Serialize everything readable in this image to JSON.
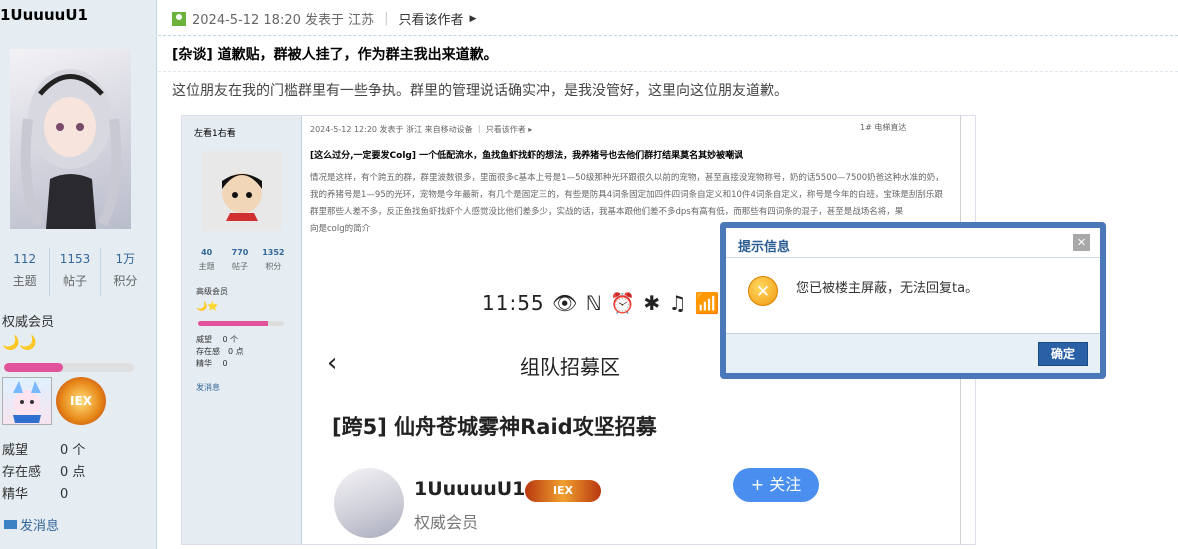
{
  "sidebar": {
    "username": "1UuuuuU1",
    "stats": [
      {
        "value": "112",
        "label": "主题"
      },
      {
        "value": "1153",
        "label": "帖子"
      },
      {
        "value": "1万",
        "label": "积分"
      }
    ],
    "rank": "权威会员",
    "rank_icons": "🌙🌙",
    "progress": 0.45,
    "medal1": "",
    "medal2": "IEX",
    "info": [
      {
        "key": "威望",
        "value": "0 个"
      },
      {
        "key": "存在感",
        "value": "0 点"
      },
      {
        "key": "精华",
        "value": "0"
      }
    ],
    "pm": "发消息"
  },
  "post": {
    "meta": "2024-5-12 18:20 发表于 江苏",
    "only_author": "只看该作者",
    "title": "[杂谈] 道歉贴，群被人挂了，作为群主我出来道歉。",
    "body": "这位朋友在我的门槛群里有一些争执。群里的管理说话确实冲，是我没管好，这里向这位朋友道歉。"
  },
  "embedded": {
    "side_label": "左看1右看",
    "avatar_glyph": "👦",
    "stats": [
      {
        "value": "40",
        "label": "主题"
      },
      {
        "value": "770",
        "label": "帖子"
      },
      {
        "value": "1352",
        "label": "积分"
      }
    ],
    "rank": "高级会员",
    "rank_icons": "🌙⭐",
    "info": [
      "威望　 0 个",
      "存在感　0 点",
      "精华　 0"
    ],
    "pm": "发消息",
    "meta": "2024-5-12 12:20 发表于 浙江 来自移动设备 ｜ 只看该作者 ▸",
    "right": "1#   电梯直达",
    "title": "[这么过分,一定要发Colg] 一个低配流水，鱼找鱼虾找虾的想法，我养猪号也去他们群打结果莫名其妙被嘲讽",
    "body": "情况是这样，有个跨五的群，群里波数很多，里面很多c基本上号是1—50级那种光环跟很久以前的宠物，甚至直接没宠物称号，奶的话5500—7500奶爸这种水准的奶，我的养猪号是1—95的光环，宠物是今年最新，有几个是固定三的，有些是防具4词条固定加四件四词条自定义和10件4词条自定义，称号是今年的白班，宝珠是刮刮乐跟群里那些人差不多，反正鱼找鱼虾找虾个人感觉没比他们差多少，实战的话，我基本跟他们差不多dps有高有低，而那些有四词条的混子，甚至是战场名将，果",
    "body_tail": "向是colg的简介",
    "phone_status": "11:55 👁 ℕ ⏰ ✱ ♫ 📶 ⁴ᴳ ▮▮▮",
    "phone_back": "‹",
    "phone_nav": "组队招募区",
    "phone_title": "[跨5] 仙舟苍城雾神Raid攻坚招募",
    "phone_user": "1UuuuuU1",
    "phone_badge": "IEX",
    "phone_rank": "权威会员",
    "follow": "+ 关注"
  },
  "modal": {
    "title": "提示信息",
    "close": "✕",
    "icon": "✕",
    "message": "您已被楼主屏蔽，无法回复ta。",
    "ok": "确定"
  },
  "colors": {
    "sidebar_bg": "#e5edf2",
    "link": "#336699",
    "modal_border": "#4a78b8",
    "modal_title": "#2b5c91",
    "ok_button": "#2a61a6",
    "progress": "#e2539c"
  }
}
